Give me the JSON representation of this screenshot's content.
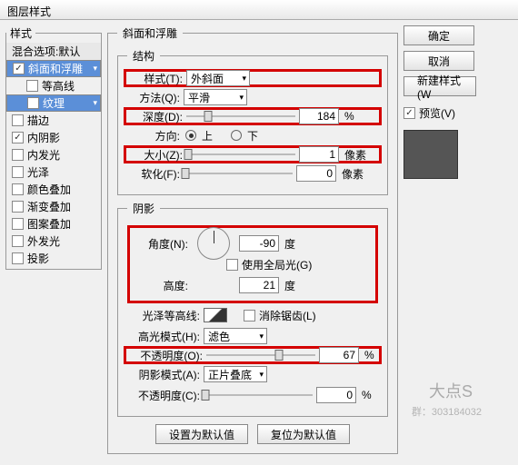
{
  "title": "图层样式",
  "styles": {
    "legend": "样式",
    "blend": "混合选项:默认",
    "items": [
      {
        "label": "斜面和浮雕",
        "checked": true,
        "sel": true
      },
      {
        "label": "等高线",
        "checked": false,
        "child": true
      },
      {
        "label": "纹理",
        "checked": false,
        "child": true,
        "sel": true
      },
      {
        "label": "描边",
        "checked": false
      },
      {
        "label": "内阴影",
        "checked": true
      },
      {
        "label": "内发光",
        "checked": false
      },
      {
        "label": "光泽",
        "checked": false
      },
      {
        "label": "颜色叠加",
        "checked": false
      },
      {
        "label": "渐变叠加",
        "checked": false
      },
      {
        "label": "图案叠加",
        "checked": false
      },
      {
        "label": "外发光",
        "checked": false
      },
      {
        "label": "投影",
        "checked": false
      }
    ]
  },
  "center": {
    "sectionTitle": "斜面和浮雕",
    "structure": {
      "legend": "结构",
      "styleLabel": "样式(T):",
      "styleValue": "外斜面",
      "methodLabel": "方法(Q):",
      "methodValue": "平滑",
      "depthLabel": "深度(D):",
      "depthValue": "184",
      "depthUnit": "%",
      "dirLabel": "方向:",
      "dirUp": "上",
      "dirDown": "下",
      "sizeLabel": "大小(Z):",
      "sizeValue": "1",
      "sizeUnit": "像素",
      "softLabel": "软化(F):",
      "softValue": "0",
      "softUnit": "像素"
    },
    "shading": {
      "legend": "阴影",
      "angleLabel": "角度(N):",
      "angleValue": "-90",
      "angleUnit": "度",
      "globalLabel": "使用全局光(G)",
      "altLabel": "高度:",
      "altValue": "21",
      "altUnit": "度",
      "glossLabel": "光泽等高线:",
      "antiLabel": "消除锯齿(L)",
      "hlModeLabel": "高光模式(H):",
      "hlModeValue": "滤色",
      "hlOpLabel": "不透明度(O):",
      "hlOpValue": "67",
      "hlOpUnit": "%",
      "shModeLabel": "阴影模式(A):",
      "shModeValue": "正片叠底",
      "shOpLabel": "不透明度(C):",
      "shOpValue": "0",
      "shOpUnit": "%"
    },
    "defaultBtn": "设置为默认值",
    "resetBtn": "复位为默认值"
  },
  "right": {
    "ok": "确定",
    "cancel": "取消",
    "newStyle": "新建样式(W",
    "previewLabel": "预览(V)"
  },
  "watermark": {
    "a": "大点S",
    "b": "群：303184032"
  }
}
